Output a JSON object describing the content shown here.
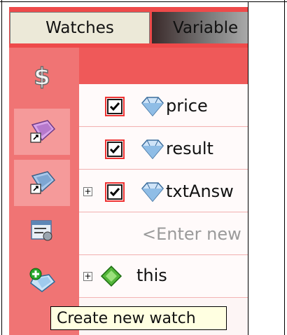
{
  "tabs": {
    "watches_label": "Watches",
    "variables_label": "Variable"
  },
  "sidebar": {
    "items": [
      {
        "name": "dollar-icon"
      },
      {
        "name": "gem-shortcut-icon"
      },
      {
        "name": "gem-shortcut-icon"
      },
      {
        "name": "settings-form-icon"
      },
      {
        "name": "add-watch-icon"
      }
    ]
  },
  "watches": [
    {
      "label": "price",
      "checked": true,
      "icon": "gem-icon",
      "expandable": false
    },
    {
      "label": "result",
      "checked": true,
      "icon": "gem-icon",
      "expandable": false
    },
    {
      "label": "txtAnsw",
      "checked": true,
      "icon": "gem-icon",
      "expandable": true
    },
    {
      "label": "<Enter new",
      "placeholder": true
    },
    {
      "label": "this",
      "icon": "green-diamond-icon",
      "expandable": true
    }
  ],
  "tooltip": {
    "text": "Create new watch"
  },
  "colors": {
    "panel": "#ee4a4a",
    "sidebar": "#f07474",
    "tooltip": "#ffffe1"
  }
}
